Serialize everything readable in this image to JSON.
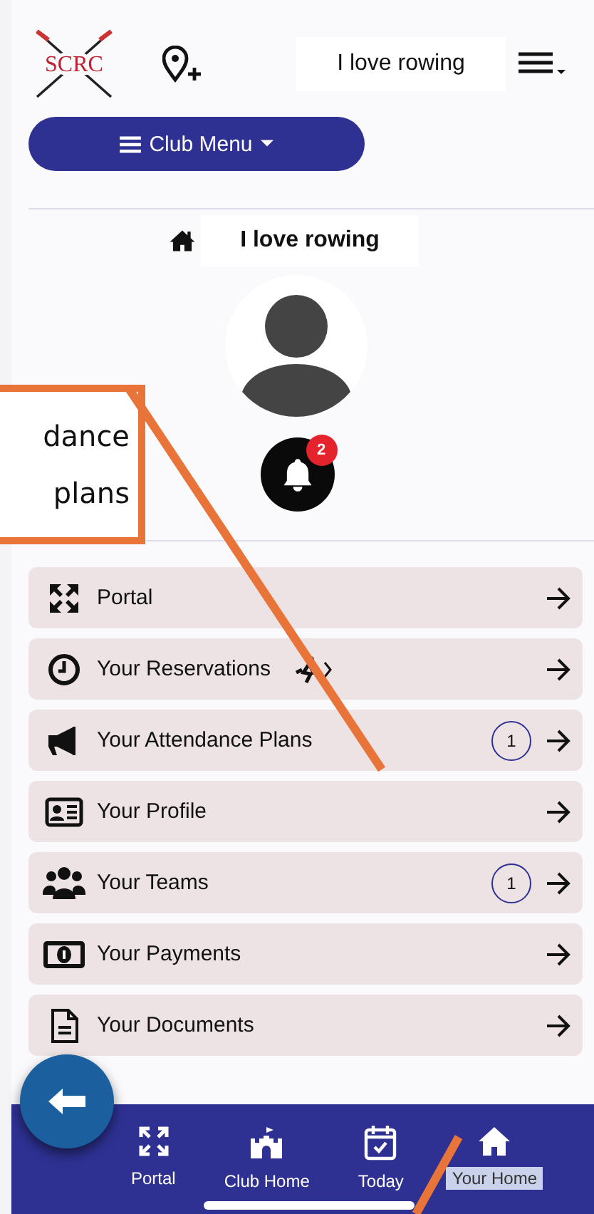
{
  "header": {
    "logo": "SCRC",
    "title": "I love rowing"
  },
  "club_menu": {
    "label": "Club Menu"
  },
  "home_heading": {
    "title": "I love rowing"
  },
  "notifications": {
    "count": "2"
  },
  "callout": {
    "lines": [
      "dance",
      "plans"
    ]
  },
  "menu_items": [
    {
      "label": "Portal"
    },
    {
      "label": "Your Reservations"
    },
    {
      "label": "Your Attendance Plans",
      "badge": "1"
    },
    {
      "label": "Your Profile"
    },
    {
      "label": "Your Teams",
      "badge": "1"
    },
    {
      "label": "Your Payments"
    },
    {
      "label": "Your Documents"
    }
  ],
  "tab_bar": [
    {
      "label": "Portal",
      "selected": false
    },
    {
      "label": "Club Home",
      "selected": false
    },
    {
      "label": "Today",
      "selected": false
    },
    {
      "label": "Your Home",
      "selected": true
    }
  ]
}
